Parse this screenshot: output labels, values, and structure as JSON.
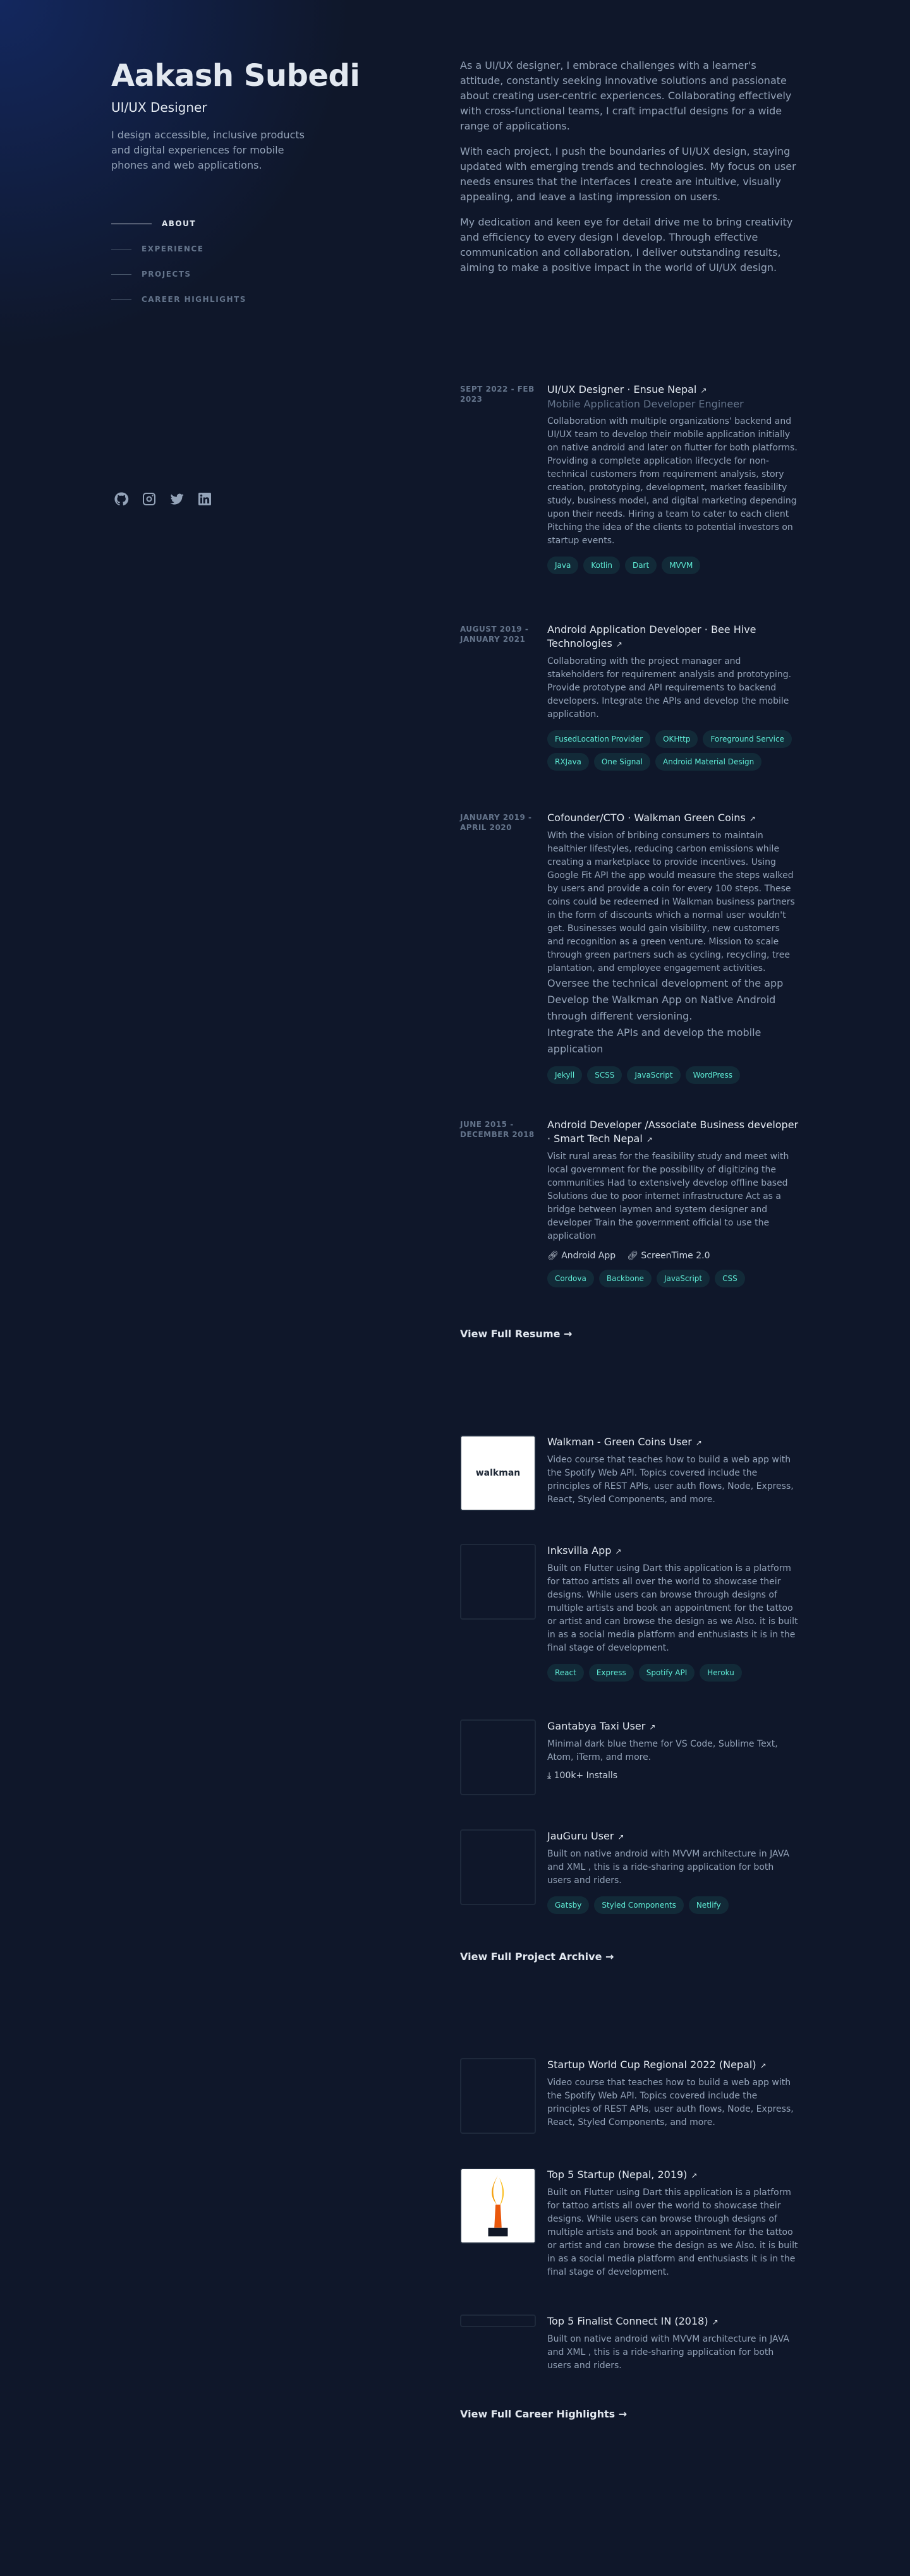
{
  "profile": {
    "name": "Aakash Subedi",
    "role": "UI/UX Designer",
    "tagline": "I design accessible, inclusive products and digital experiences for mobile phones and web applications."
  },
  "nav": [
    "ABOUT",
    "EXPERIENCE",
    "PROJECTS",
    "CAREER HIGHLIGHTS"
  ],
  "socials": [
    "github-icon",
    "instagram-icon",
    "twitter-icon",
    "linkedin-icon"
  ],
  "about": [
    "As a UI/UX designer, I embrace challenges with a learner's attitude, constantly seeking innovative solutions and passionate about creating user-centric experiences. Collaborating effectively with cross-functional teams, I craft impactful designs for a wide range of applications.",
    "With each project, I push the boundaries of UI/UX design, staying updated with emerging trends and technologies. My focus on user needs ensures that the interfaces I create are intuitive, visually appealing, and leave a lasting impression on users.",
    "My dedication and keen eye for detail drive me to bring creativity and efficiency to every design I develop. Through effective communication and collaboration, I deliver outstanding results, aiming to make a positive impact in the world of UI/UX design."
  ],
  "experience": [
    {
      "date": "SEPT 2022 - FEB 2023",
      "title": "UI/UX Designer · Ensue Nepal",
      "subtitle": "Mobile Application Developer Engineer",
      "desc": "Collaboration with multiple organizations' backend and UI/UX team to develop their mobile application initially on native android and later on flutter for both platforms. Providing a complete application lifecycle for non-technical customers from requirement analysis, story creation, prototyping, development, market feasibility study, business model, and digital marketing depending upon their needs. Hiring a team to cater to each client Pitching the idea of the clients to potential investors on startup events.",
      "tags": [
        "Java",
        "Kotlin",
        "Dart",
        "MVVM"
      ]
    },
    {
      "date": "AUGUST 2019 - JANUARY 2021",
      "title": "Android Application Developer · Bee Hive Technologies",
      "desc": "Collaborating with the project manager and stakeholders for requirement analysis and prototyping. Provide prototype and API requirements to backend developers. Integrate the APIs and develop the mobile application.",
      "tags": [
        "FusedLocation Provider",
        "OKHttp",
        "Foreground Service",
        "RXJava",
        "One Signal",
        "Android Material Design"
      ]
    },
    {
      "date": "JANUARY 2019 - APRIL 2020",
      "title": "Cofounder/CTO · Walkman Green Coins",
      "desc": "With the vision of bribing consumers to maintain healthier lifestyles, reducing carbon emissions while creating a marketplace to provide incentives. Using Google Fit API the app would measure the steps walked by users and provide a coin for every 100 steps. These coins could be redeemed in Walkman business partners in the form of discounts which a normal user wouldn't get. Businesses would gain visibility, new customers and recognition as a green venture. Mission to scale through green partners such as cycling, recycling, tree plantation, and employee engagement activities.",
      "desc2": "Oversee the technical development of the app Develop the Walkman App on Native Android through different versioning.\nIntegrate the APIs and develop the mobile application",
      "tags": [
        "Jekyll",
        "SCSS",
        "JavaScript",
        "WordPress"
      ]
    },
    {
      "date": "JUNE 2015 - DECEMBER 2018",
      "title": "Android Developer /Associate Business developer · Smart Tech Nepal",
      "desc": "Visit rural areas for the feasibility study and meet with local government for the possibility of digitizing the communities Had to extensively develop offline based Solutions due to poor internet infrastructure Act as a bridge between laymen and system designer and developer Train the government official to use the application",
      "links": [
        "Android App",
        "ScreenTime 2.0"
      ],
      "tags": [
        "Cordova",
        "Backbone",
        "JavaScript",
        "CSS"
      ]
    }
  ],
  "view_resume": "View Full Resume",
  "projects": [
    {
      "title": "Walkman - Green Coins User",
      "desc": "Video course that teaches how to build a web app with the Spotify Web API. Topics covered include the principles of REST APIs, user auth flows, Node, Express, React, Styled Components, and more.",
      "logo_text": "walkman",
      "tags": []
    },
    {
      "title": "Inksvilla App",
      "desc": "Built on Flutter using Dart this application is a platform for tattoo artists all over the world to showcase their designs. While users can browse through designs of multiple artists and book an appointment for the tattoo or artist and can browse the design as we Also. it is built in as a social media platform and enthusiasts it is in the final stage of development.",
      "tags": [
        "React",
        "Express",
        "Spotify API",
        "Heroku"
      ]
    },
    {
      "title": "Gantabya Taxi User",
      "desc": "Minimal dark blue theme for VS Code, Sublime Text, Atom, iTerm, and more.",
      "installs": "100k+ Installs",
      "tags": []
    },
    {
      "title": "JauGuru User",
      "desc": "Built on native android with MVVM architecture in JAVA and XML , this is a ride-sharing application for both users and riders.",
      "tags": [
        "Gatsby",
        "Styled Components",
        "Netlify"
      ]
    }
  ],
  "view_archive": "View Full Project Archive",
  "highlights": [
    {
      "title": "Startup World Cup Regional 2022 (Nepal)",
      "desc": "Video course that teaches how to build a web app with the Spotify Web API. Topics covered include the principles of REST APIs, user auth flows, Node, Express, React, Styled Components, and more."
    },
    {
      "title": "Top 5 Startup (Nepal, 2019)",
      "desc": "Built on Flutter using Dart this application is a platform for tattoo artists all over the world to showcase their designs. While users can browse through designs of multiple artists and book an appointment for the tattoo or artist and can browse the design as we Also. it is built in as a social media platform and enthusiasts it is in the final stage of development."
    },
    {
      "title": "Top 5 Finalist Connect IN (2018)",
      "desc": "Built on native android with MVVM architecture in JAVA and XML , this is a ride-sharing application for both users and riders."
    }
  ],
  "view_highlights": "View Full Career Highlights",
  "colors": {
    "bg": "#0f172a",
    "accent": "#5eead4",
    "heading": "#e2e8f0",
    "text": "#94a3b8"
  }
}
